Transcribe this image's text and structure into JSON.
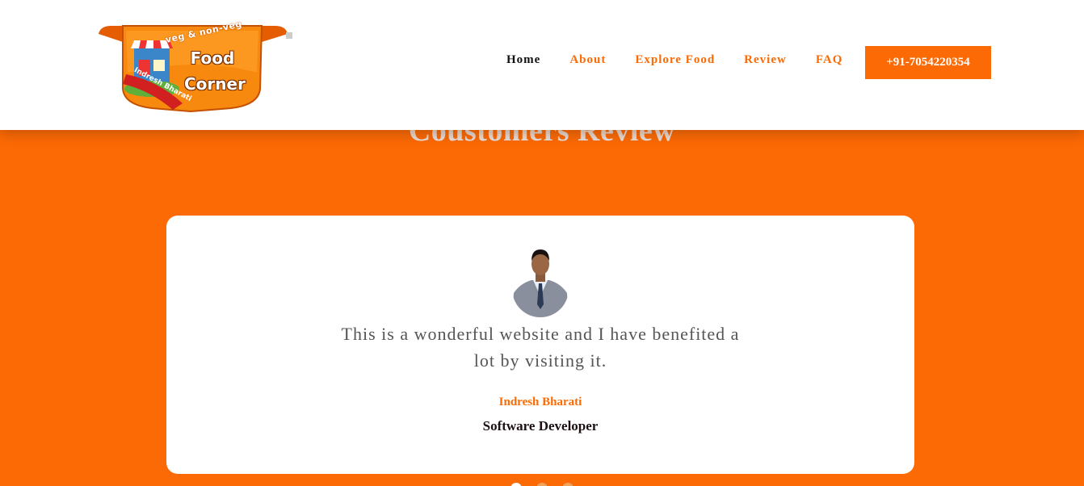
{
  "header": {
    "logo": {
      "top_text": "veg & non-veg",
      "main_text_line1": "Food",
      "main_text_line2": "Corner",
      "ribbon_text": "Indresh Bharati"
    },
    "nav": [
      {
        "label": "Home",
        "active": true
      },
      {
        "label": "About",
        "active": false
      },
      {
        "label": "Explore Food",
        "active": false
      },
      {
        "label": "Review",
        "active": false
      },
      {
        "label": "FAQ",
        "active": false
      }
    ],
    "phone_button": "+91-7054220354"
  },
  "section": {
    "title": "Coustomers Review"
  },
  "review": {
    "quote": "This is a wonderful website and I have benefited a lot by visiting it.",
    "name": "Indresh Bharati",
    "role": "Software Developer"
  },
  "carousel": {
    "dots": 3,
    "active_index": 0
  },
  "colors": {
    "accent": "#fc6a05",
    "header_bg": "#ffffff",
    "card_bg": "#ffffff",
    "nav_active": "#111111"
  }
}
